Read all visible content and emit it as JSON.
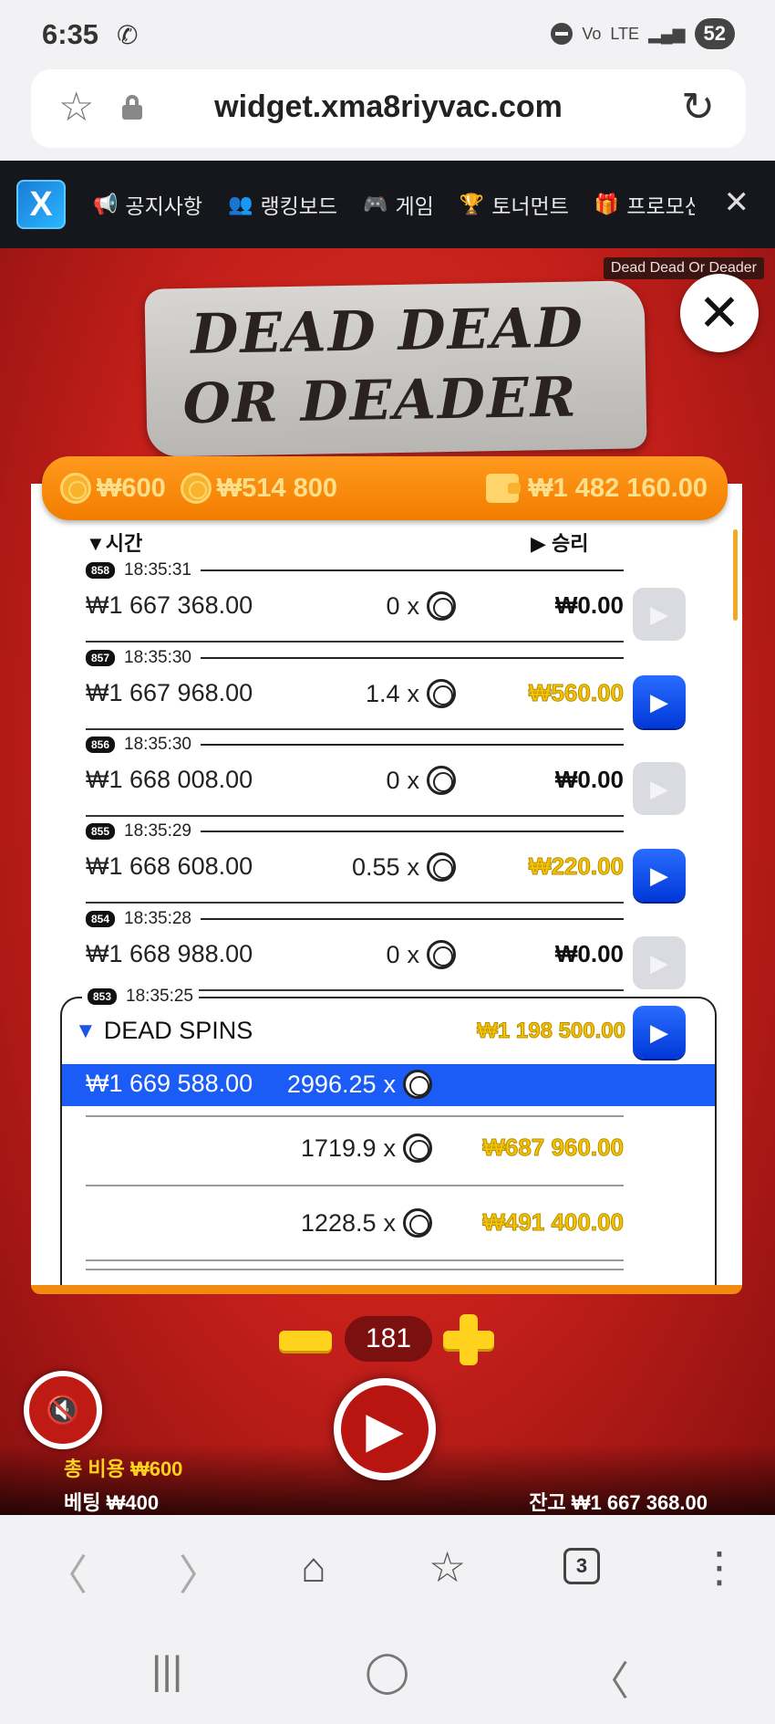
{
  "status_bar": {
    "time": "6:35",
    "battery": "52",
    "network": "LTE"
  },
  "browser": {
    "url": "widget.xma8riyvac.com",
    "tab_count": "3"
  },
  "nav": {
    "items": [
      {
        "icon": "megaphone-icon",
        "label": "공지사항"
      },
      {
        "icon": "users-icon",
        "label": "랭킹보드"
      },
      {
        "icon": "gamepad-icon",
        "label": "게임"
      },
      {
        "icon": "trophy-icon",
        "label": "토너먼트"
      },
      {
        "icon": "gift-icon",
        "label": "프로모션"
      }
    ]
  },
  "game": {
    "tag": "Dead Dead Or Deader",
    "logo_line1": "DEAD DEAD",
    "logo_line2": "OR DEADER",
    "header": {
      "cost1": "₩600",
      "cost2": "₩514 800",
      "wallet": "₩1 482 160.00"
    },
    "history": {
      "col_time": "▼시간",
      "col_win": "▶ 승리",
      "rows": [
        {
          "round": "858",
          "time": "18:35:31",
          "balance": "₩1 667 368.00",
          "mult": "0",
          "win": "₩0.00",
          "gold": false,
          "replay": false
        },
        {
          "round": "857",
          "time": "18:35:30",
          "balance": "₩1 667 968.00",
          "mult": "1.4",
          "win": "₩560.00",
          "gold": true,
          "replay": true
        },
        {
          "round": "856",
          "time": "18:35:30",
          "balance": "₩1 668 008.00",
          "mult": "0",
          "win": "₩0.00",
          "gold": false,
          "replay": false
        },
        {
          "round": "855",
          "time": "18:35:29",
          "balance": "₩1 668 608.00",
          "mult": "0.55",
          "win": "₩220.00",
          "gold": true,
          "replay": true
        },
        {
          "round": "854",
          "time": "18:35:28",
          "balance": "₩1 668 988.00",
          "mult": "0",
          "win": "₩0.00",
          "gold": false,
          "replay": false
        }
      ],
      "dead_spins": {
        "round": "853",
        "time": "18:35:25",
        "label": "DEAD SPINS",
        "total": "₩1 198 500.00",
        "selected": {
          "balance": "₩1 669 588.00",
          "mult": "2996.25"
        },
        "spins": [
          {
            "mult": "1719.9",
            "win": "₩687 960.00"
          },
          {
            "mult": "1228.5",
            "win": "₩491 400.00"
          }
        ]
      }
    },
    "controls": {
      "count": "181"
    },
    "footer": {
      "cost": "총 비용  ₩600",
      "bet": "베팅  ₩400",
      "balance": "잔고  ₩1 667 368.00"
    }
  }
}
